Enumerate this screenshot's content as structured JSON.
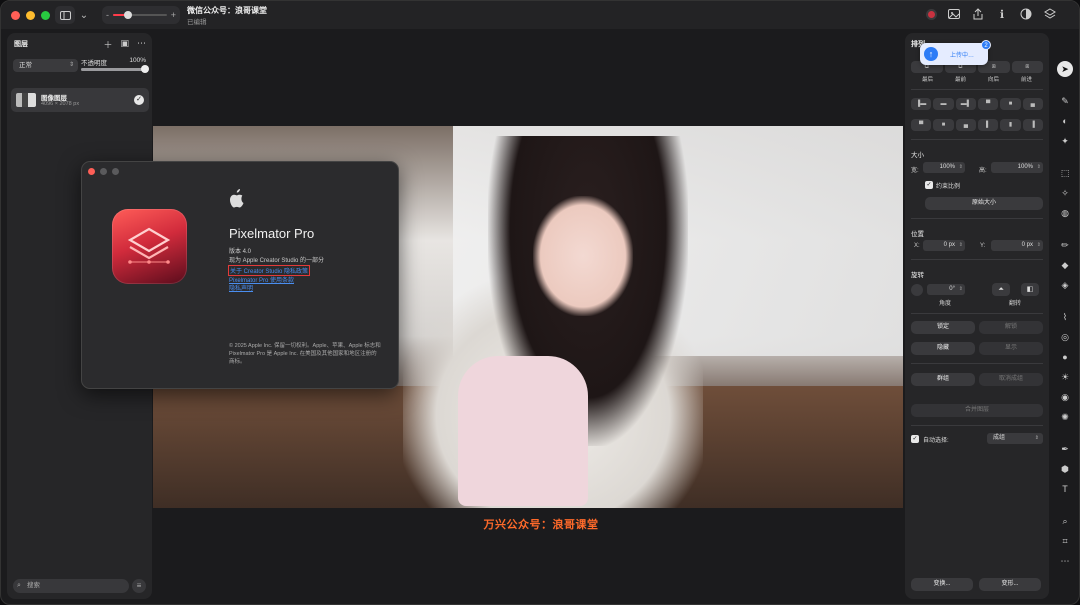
{
  "titlebar": {
    "doc_title": "微信公众号：浪哥课堂",
    "doc_status": "已编辑",
    "zoom_minus": "-",
    "zoom_plus": "+",
    "zoom_level": 0.28
  },
  "layers_panel": {
    "title": "图层",
    "blend_mode": "正常",
    "opacity_label": "不透明度",
    "opacity_value": "100%",
    "opacity_fraction": 1.0,
    "layers": [
      {
        "name": "图像图层",
        "size": "4096 × 2078 px",
        "visible": true
      }
    ],
    "search_placeholder": "搜索"
  },
  "about_dialog": {
    "app_name": "Pixelmator Pro",
    "version": "版本 4.0",
    "part_of": "现为 Apple Creator Studio 的一部分",
    "link1": "关于 Creator Studio 隐私政策",
    "link2": "Pixelmator Pro 使用条款",
    "link3": "隐私声明",
    "copyright": "© 2025 Apple Inc. 保留一切权利。Apple、苹果、Apple 标志和 Pixelmator Pro 是 Apple Inc. 在美国及其他国家和地区注册的商标。"
  },
  "watermark": "万兴公众号：浪哥课堂",
  "upload_toast": {
    "text": "上传中…",
    "badge": "2"
  },
  "arrange_panel": {
    "title": "排列",
    "arrange_labels": [
      "最后",
      "最前",
      "向后",
      "前进"
    ],
    "size_title": "大小",
    "width_label": "宽:",
    "width_value": "100%",
    "height_label": "高:",
    "height_value": "100%",
    "constrain_label": "约束比例",
    "original_size_button": "原始大小",
    "position_title": "位置",
    "x_label": "X:",
    "x_value": "0 px",
    "y_label": "Y:",
    "y_value": "0 px",
    "rotate_title": "旋转",
    "angle_value": "0°",
    "angle_label": "角度",
    "flip_label": "翻转",
    "lock_button": "锁定",
    "unlock_button": "解锁",
    "hide_button": "隐藏",
    "show_button": "显示",
    "group_button": "群组",
    "ungroup_button": "取消成组",
    "merge_button": "合并图层",
    "auto_select_label": "自动选择:",
    "auto_select_value": "成组",
    "transform_button": "变换...",
    "distort_button": "变形..."
  },
  "colors": {
    "accent_red": "#ff3b4a",
    "link_blue": "#4a8ef0",
    "watermark_orange": "#ff6a2a",
    "toast_blue": "#2d7cf6"
  }
}
